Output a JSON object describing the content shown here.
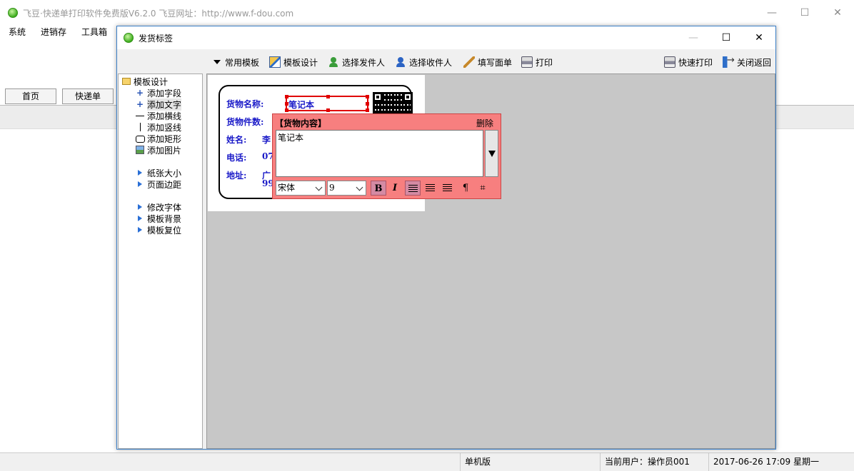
{
  "main_window": {
    "title": "飞豆·快递单打印软件免费版V6.2.0  飞豆网址：http://www.f-dou.com",
    "controls": {
      "minimize": "—",
      "maximize": "☐",
      "close": "✕"
    }
  },
  "menu": [
    "系统",
    "进销存",
    "工具箱"
  ],
  "main_tabs": [
    "首页",
    "快递单"
  ],
  "statusbar": {
    "mode": "单机版",
    "user": "当前用户：操作员001",
    "datetime": "2017-06-26 17:09 星期一"
  },
  "dialog": {
    "title": "发货标签",
    "controls": {
      "minimize": "—",
      "maximize": "☐",
      "close": "✕"
    }
  },
  "toolbar": {
    "common_templates": "常用模板",
    "template_design": "模板设计",
    "choose_sender": "选择发件人",
    "choose_recipient": "选择收件人",
    "fill_form": "填写面单",
    "print": "打印",
    "quick_print": "快速打印",
    "close_return": "关闭返回"
  },
  "tree": {
    "root": "模板设计",
    "items": [
      {
        "label": "添加字段",
        "icon": "plus-icon"
      },
      {
        "label": "添加文字",
        "icon": "plus-icon",
        "selected": true
      },
      {
        "label": "添加横线",
        "icon": "hline-icon"
      },
      {
        "label": "添加竖线",
        "icon": "vline-icon"
      },
      {
        "label": "添加矩形",
        "icon": "rect-icon"
      },
      {
        "label": "添加图片",
        "icon": "image-icon"
      }
    ],
    "group2": [
      "纸张大小",
      "页面边距"
    ],
    "group3": [
      "修改字体",
      "模板背景",
      "模板复位"
    ]
  },
  "label": {
    "goods_name_label": "货物名称:",
    "goods_name_value": "笔记本",
    "goods_count_label": "货物件数:",
    "name_label": "姓名:",
    "name_value": "李",
    "phone_label": "电话:",
    "phone_value": "07",
    "address_label": "地址:",
    "address_value_1": "广",
    "address_value_2": "99"
  },
  "popup": {
    "title": "【货物内容】",
    "delete": "删除",
    "content": "笔记本",
    "font": "宋体",
    "size": "9",
    "bold": "B",
    "italic": "I"
  },
  "colors": {
    "label_text": "#1a1ac8",
    "selection": "#e00000",
    "popup_bg": "#f77f7f",
    "canvas_bg": "#c7c7c7"
  }
}
